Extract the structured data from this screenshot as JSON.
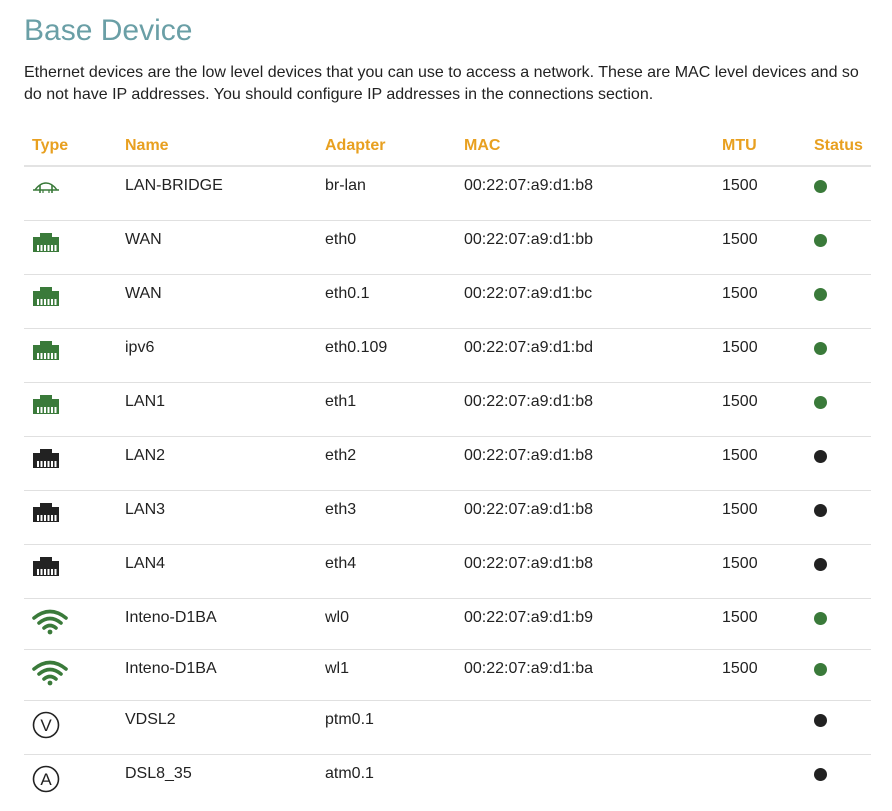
{
  "page": {
    "title": "Base Device",
    "description": "Ethernet devices are the low level devices that you can use to access a network. These are MAC level devices and so do not have IP addresses. You should configure IP addresses in the connections section."
  },
  "table": {
    "headers": {
      "type": "Type",
      "name": "Name",
      "adapter": "Adapter",
      "mac": "MAC",
      "mtu": "MTU",
      "status": "Status"
    },
    "rows": [
      {
        "type_icon": "bridge-icon",
        "name": "LAN-BRIDGE",
        "adapter": "br-lan",
        "mac": "00:22:07:a9:d1:b8",
        "mtu": "1500",
        "status": "up"
      },
      {
        "type_icon": "ethernet-port-icon",
        "name": "WAN",
        "adapter": "eth0",
        "mac": "00:22:07:a9:d1:bb",
        "mtu": "1500",
        "status": "up"
      },
      {
        "type_icon": "ethernet-port-icon",
        "name": "WAN",
        "adapter": "eth0.1",
        "mac": "00:22:07:a9:d1:bc",
        "mtu": "1500",
        "status": "up"
      },
      {
        "type_icon": "ethernet-port-icon",
        "name": "ipv6",
        "adapter": "eth0.109",
        "mac": "00:22:07:a9:d1:bd",
        "mtu": "1500",
        "status": "up"
      },
      {
        "type_icon": "ethernet-port-icon",
        "name": "LAN1",
        "adapter": "eth1",
        "mac": "00:22:07:a9:d1:b8",
        "mtu": "1500",
        "status": "up"
      },
      {
        "type_icon": "ethernet-port-icon",
        "name": "LAN2",
        "adapter": "eth2",
        "mac": "00:22:07:a9:d1:b8",
        "mtu": "1500",
        "status": "down"
      },
      {
        "type_icon": "ethernet-port-icon",
        "name": "LAN3",
        "adapter": "eth3",
        "mac": "00:22:07:a9:d1:b8",
        "mtu": "1500",
        "status": "down"
      },
      {
        "type_icon": "ethernet-port-icon",
        "name": "LAN4",
        "adapter": "eth4",
        "mac": "00:22:07:a9:d1:b8",
        "mtu": "1500",
        "status": "down"
      },
      {
        "type_icon": "wifi-icon",
        "name": "Inteno-D1BA",
        "adapter": "wl0",
        "mac": "00:22:07:a9:d1:b9",
        "mtu": "1500",
        "status": "up"
      },
      {
        "type_icon": "wifi-icon",
        "name": "Inteno-D1BA",
        "adapter": "wl1",
        "mac": "00:22:07:a9:d1:ba",
        "mtu": "1500",
        "status": "up"
      },
      {
        "type_icon": "vdsl-icon",
        "name": "VDSL2",
        "adapter": "ptm0.1",
        "mac": "",
        "mtu": "",
        "status": "down"
      },
      {
        "type_icon": "adsl-icon",
        "name": "DSL8_35",
        "adapter": "atm0.1",
        "mac": "",
        "mtu": "",
        "status": "down"
      }
    ]
  },
  "colors": {
    "title": "#6a9fa6",
    "header": "#e8a020",
    "status_up": "#3a7a3a",
    "status_down": "#222222",
    "icon_up": "#3a7a3a",
    "icon_down": "#222222"
  }
}
